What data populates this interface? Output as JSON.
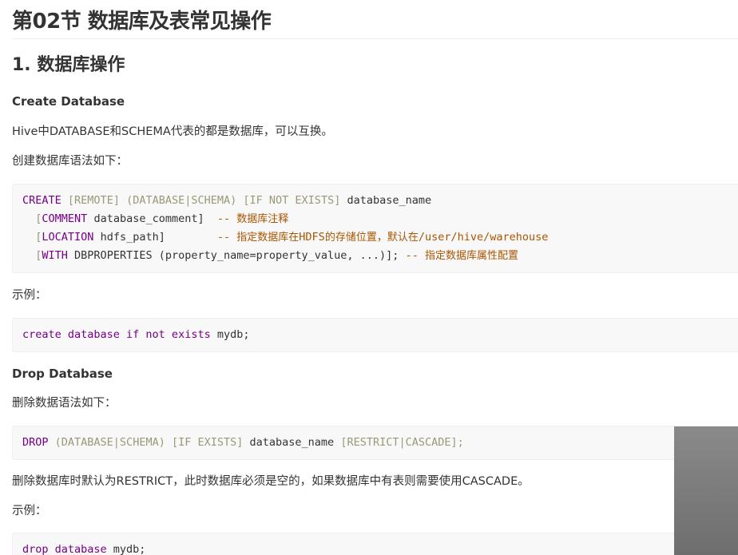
{
  "doc": {
    "title": "第02节 数据库及表常见操作",
    "section1": "1. 数据库操作",
    "create_heading": "Create Database",
    "create_p1": "Hive中DATABASE和SCHEMA代表的都是数据库，可以互换。",
    "create_p2": "创建数据库语法如下：",
    "create_code": {
      "l1": {
        "create": "CREATE",
        "remote": "[REMOTE]",
        "db_schema": "(DATABASE|SCHEMA)",
        "if_not_exists": "[IF NOT EXISTS]",
        "name": "database_name"
      },
      "l2": {
        "open": "[",
        "kw": "COMMENT",
        "rest": " database_comment]",
        "dash": "--",
        "comment": "数据库注释"
      },
      "l3": {
        "open": "[",
        "kw": "LOCATION",
        "rest": " hdfs_path]",
        "dash": "--",
        "comment_a": "指定数据库在",
        "comment_b": "HDFS",
        "comment_c": "的存储位置，默认在",
        "comment_d": "/user/hive/warehouse"
      },
      "l4": {
        "open": "[",
        "kw": "WITH",
        "rest": " DBPROPERTIES (property_name=property_value, ...)];",
        "dash": "--",
        "comment": "指定数据库属性配置"
      }
    },
    "example_label_1": "示例：",
    "example_code_1": {
      "kw": "create database if not exists",
      "name": " mydb;"
    },
    "drop_heading": "Drop Database",
    "drop_p1": "删除数据语法如下：",
    "drop_code": {
      "drop": "DROP",
      "db_schema": "(DATABASE|SCHEMA)",
      "if_exists": "[IF EXISTS]",
      "name": "database_name",
      "restrict": "[RESTRICT|CASCADE];"
    },
    "drop_p2": "删除数据库时默认为RESTRICT，此时数据库必须是空的，如果数据库中有表则需要使用CASCADE。",
    "example_label_2": "示例：",
    "example_code_2": {
      "kw": "drop database",
      "name": " mydb;"
    }
  }
}
